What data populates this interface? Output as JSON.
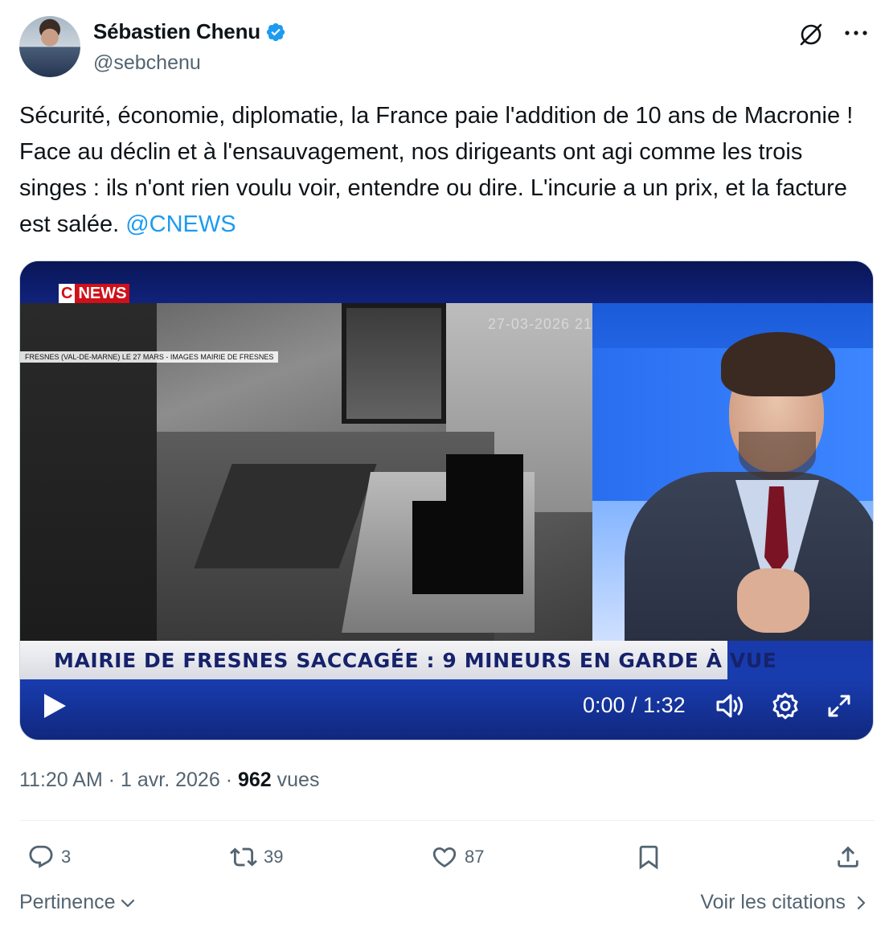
{
  "author": {
    "display_name": "Sébastien Chenu",
    "handle": "@sebchenu",
    "verified_color": "#1d9bf0"
  },
  "tweet": {
    "text": "Sécurité, économie, diplomatie, la France paie l'addition de 10 ans de Macronie ! Face au déclin et à l'ensauvagement, nos dirigeants ont agi comme les trois singes : ils n'ont rien voulu voir, entendre ou dire. L'incurie a un prix, et la facture est salée. ",
    "mention": "@CNEWS",
    "mention_color": "#1d9bf0"
  },
  "video": {
    "channel_logo_c": "C",
    "channel_logo_news": "NEWS",
    "cctv_caption": "FRESNES (VAL-DE-MARNE) LE 27 MARS - IMAGES MAIRIE DE FRESNES",
    "cctv_timestamp": "27-03-2026 21",
    "headline": "MAIRIE DE FRESNES SACCAGÉE : 9 MINEURS EN GARDE À VUE",
    "time_display": "0:00 / 1:32",
    "progress": 0
  },
  "meta": {
    "time": "11:20 AM",
    "date": "1 avr. 2026",
    "views_count": "962",
    "views_label": "vues",
    "separator": "·"
  },
  "actions": {
    "reply_count": "3",
    "repost_count": "39",
    "like_count": "87"
  },
  "footer": {
    "sort_label": "Pertinence",
    "quotes_label": "Voir les citations"
  },
  "icons": [
    "verified-badge-icon",
    "grok-icon",
    "more-icon",
    "play-icon",
    "volume-icon",
    "settings-icon",
    "fullscreen-icon",
    "reply-icon",
    "repost-icon",
    "like-icon",
    "bookmark-icon",
    "share-icon",
    "chevron-down-icon",
    "chevron-right-icon"
  ]
}
